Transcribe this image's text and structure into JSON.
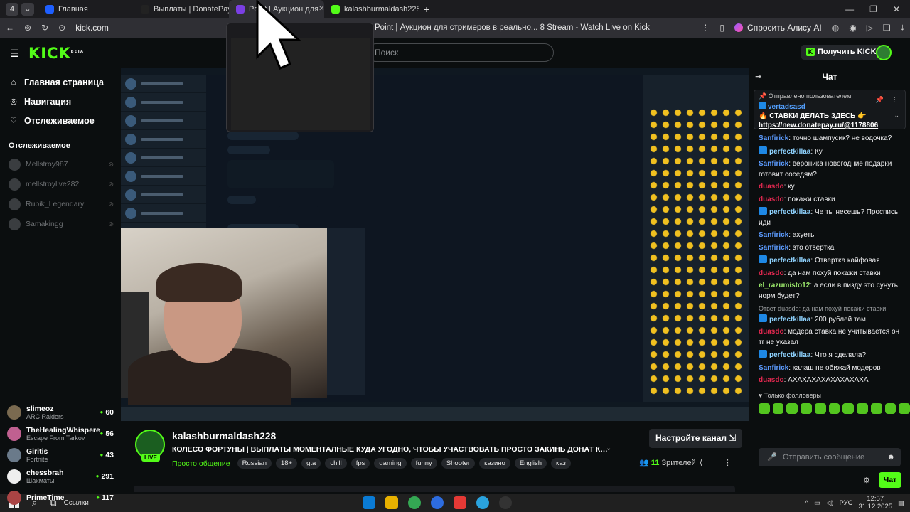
{
  "browser": {
    "tabs": [
      {
        "label": "Главная",
        "color": "#1e5fff"
      },
      {
        "label": "Выплаты | DonatePay",
        "color": "#222"
      },
      {
        "label": "Point | Аукцион для",
        "color": "#7b3fe4"
      },
      {
        "label": "kalashburmaldash228 S",
        "color": "#53fc18"
      }
    ],
    "url": "kick.com",
    "page_title": "Point | Аукцион для стримеров в реально... 8 Stream - Watch Live on Kick",
    "alisa_label": "Спросить Алису AI"
  },
  "header": {
    "logo": "KICK",
    "logo_badge": "BETA",
    "search_placeholder": "Поиск",
    "get_kicks_label": "Получить KICKs"
  },
  "sidebar": {
    "nav": [
      {
        "label": "Главная страница",
        "icon": "home-icon"
      },
      {
        "label": "Навигация",
        "icon": "compass-icon"
      },
      {
        "label": "Отслеживаемое",
        "icon": "heart-icon"
      }
    ],
    "following_title": "Отслеживаемое",
    "following": [
      "Mellstroy987",
      "mellstroylive282",
      "Rubik_Legendary",
      "Samakingg"
    ],
    "recommended": [
      {
        "name": "slimeoz",
        "category": "ARC Raiders",
        "viewers": "60",
        "color": "#7a6a50"
      },
      {
        "name": "TheHealingWhisperer",
        "category": "Escape From Tarkov",
        "viewers": "56",
        "color": "#c06090"
      },
      {
        "name": "Giritis",
        "category": "Fortnite",
        "viewers": "43",
        "color": "#6a7a8a"
      },
      {
        "name": "chessbrah",
        "category": "Шахматы",
        "viewers": "291",
        "color": "#eeeeee"
      },
      {
        "name": "PrimeTime",
        "category": "",
        "viewers": "117",
        "color": "#aa4444"
      }
    ]
  },
  "stream": {
    "streamer": "kalashburmaldash228",
    "live_label": "LIVE",
    "title": "КОЛЕСО ФОРТУНЫ | ВЫПЛАТЫ МОМЕНТАЛНЫЕ КУДА УГОДНО, ЧТОБЫ УЧАСТВОВАТЬ ПРОСТО ЗАКИНЬ ДОНАТ КОТОРЫЙ С...",
    "category": "Просто общение",
    "tags": [
      "Russian",
      "18+",
      "gta",
      "chill",
      "fps",
      "gaming",
      "funny",
      "Shooter",
      "казино",
      "English",
      "каз"
    ],
    "configure_label": "Настройте канал",
    "viewers_count": "11",
    "viewers_label": "Зрителей"
  },
  "chat": {
    "title": "Чат",
    "pinned": {
      "label": "Отправлено пользователем",
      "user": "vertadsasd",
      "message": "🔥 СТАВКИ ДЕЛАТЬ ЗДЕСЬ 👉",
      "link": "https://new.donatepay.ru/@1178806"
    },
    "messages": [
      {
        "user": "Sanfirick",
        "color": "#5b9bff",
        "badge": false,
        "text": "точно шампусик? не водочка?"
      },
      {
        "user": "perfectkillaa",
        "color": "#8fd3ff",
        "badge": true,
        "text": "Ку"
      },
      {
        "user": "Sanfirick",
        "color": "#5b9bff",
        "badge": false,
        "text": "вероника новогодние подарки готовит соседям?"
      },
      {
        "user": "duasdo",
        "color": "#e0284f",
        "badge": false,
        "text": "ку"
      },
      {
        "user": "duasdo",
        "color": "#e0284f",
        "badge": false,
        "text": "покажи ставки"
      },
      {
        "user": "perfectkillaa",
        "color": "#8fd3ff",
        "badge": true,
        "text": "Че ты несешь? Проспись иди"
      },
      {
        "user": "Sanfirick",
        "color": "#5b9bff",
        "badge": false,
        "text": "ахуеть"
      },
      {
        "user": "Sanfirick",
        "color": "#5b9bff",
        "badge": false,
        "text": "это отвертка"
      },
      {
        "user": "perfectkillaa",
        "color": "#8fd3ff",
        "badge": true,
        "text": "Отвертка кайфовая"
      },
      {
        "user": "duasdo",
        "color": "#e0284f",
        "badge": false,
        "text": "да нам похуй покажи ставки"
      },
      {
        "user": "el_razumisto12",
        "color": "#9be86b",
        "badge": false,
        "text": "а если в пизду это сунуть норм будет?"
      },
      {
        "reply": "Ответ duasdo: да нам похуй покажи ставки",
        "user": "perfectkillaa",
        "color": "#8fd3ff",
        "badge": true,
        "text": "200 рублей там"
      },
      {
        "user": "duasdo",
        "color": "#e0284f",
        "badge": false,
        "text": "модера ставка не учитывается он тг не указал"
      },
      {
        "user": "perfectkillaa",
        "color": "#8fd3ff",
        "badge": true,
        "text": "Что я сделала?"
      },
      {
        "user": "Sanfirick",
        "color": "#5b9bff",
        "badge": false,
        "text": "калаш не обижай модеров"
      },
      {
        "user": "duasdo",
        "color": "#e0284f",
        "badge": false,
        "text": "АХАХАХАХАХАХАХАХА"
      }
    ],
    "followers_only": "Только фолловеры",
    "input_placeholder": "Отправить сообщение",
    "send_label": "Чат"
  },
  "taskbar": {
    "search_label": "Ссылки",
    "lang": "РУС",
    "time": "12:57",
    "date": "31.12.2025"
  }
}
